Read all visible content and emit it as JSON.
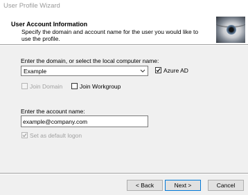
{
  "window": {
    "title": "User Profile Wizard"
  },
  "header": {
    "title": "User Account Information",
    "description": "Specify the domain and account name for the user you would like to use the profile."
  },
  "domain": {
    "label": "Enter the domain, or select the local computer name:",
    "value": "Example",
    "azure_ad": {
      "label": "Azure AD",
      "checked": true
    },
    "join_domain": {
      "label": "Join Domain",
      "checked": false,
      "enabled": false
    },
    "join_workgroup": {
      "label": "Join Workgroup",
      "checked": false
    }
  },
  "account": {
    "label": "Enter the account name:",
    "value": "example@company.com",
    "set_default_logon": {
      "label": "Set as default logon",
      "checked": true,
      "enabled": false
    }
  },
  "buttons": {
    "back": "< Back",
    "next": "Next >",
    "cancel": "Cancel"
  }
}
